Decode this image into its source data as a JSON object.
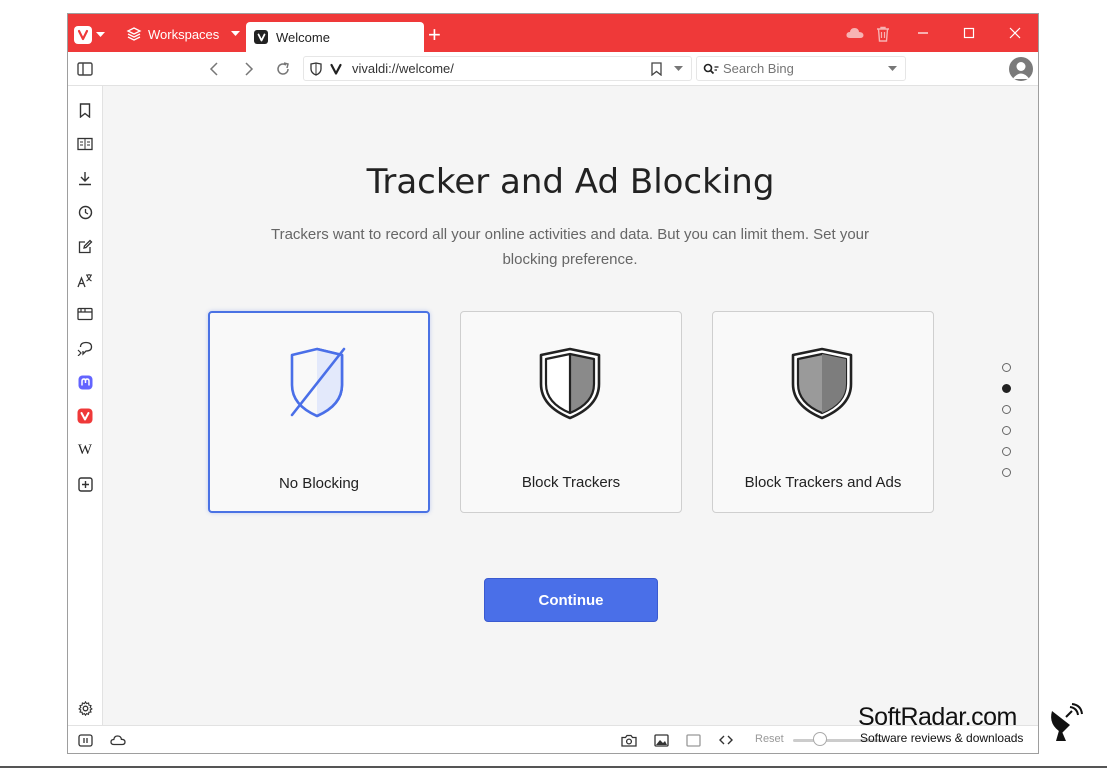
{
  "tabbar": {
    "workspaces_label": "Workspaces",
    "active_tab_title": "Welcome",
    "new_tab_symbol": "+"
  },
  "addressbar": {
    "url": "vivaldi://welcome/",
    "search_placeholder": "Search Bing"
  },
  "sidepanel": {
    "items": [
      {
        "name": "bookmark-icon"
      },
      {
        "name": "reading-list-icon"
      },
      {
        "name": "download-icon"
      },
      {
        "name": "history-icon"
      },
      {
        "name": "notes-icon"
      },
      {
        "name": "translate-icon"
      },
      {
        "name": "window-panel-icon"
      },
      {
        "name": "feed-reader-icon"
      },
      {
        "name": "mastodon-icon"
      },
      {
        "name": "vivaldi-icon"
      },
      {
        "name": "wikipedia-icon",
        "label": "W"
      },
      {
        "name": "add-panel-icon"
      }
    ]
  },
  "main": {
    "title": "Tracker and Ad Blocking",
    "subtitle": "Trackers want to record all your online activities and data. But you can limit them. Set your blocking preference.",
    "options": [
      {
        "label": "No Blocking",
        "selected": true
      },
      {
        "label": "Block Trackers",
        "selected": false
      },
      {
        "label": "Block Trackers and Ads",
        "selected": false
      }
    ],
    "continue_label": "Continue",
    "steps": {
      "total": 6,
      "current": 2
    }
  },
  "statusbar": {
    "reset_label": "Reset"
  },
  "watermark": {
    "title": "SoftRadar.com",
    "subtitle": "Software reviews & downloads"
  },
  "colors": {
    "brand_red": "#ef3939",
    "accent_blue": "#4a6fe8"
  }
}
